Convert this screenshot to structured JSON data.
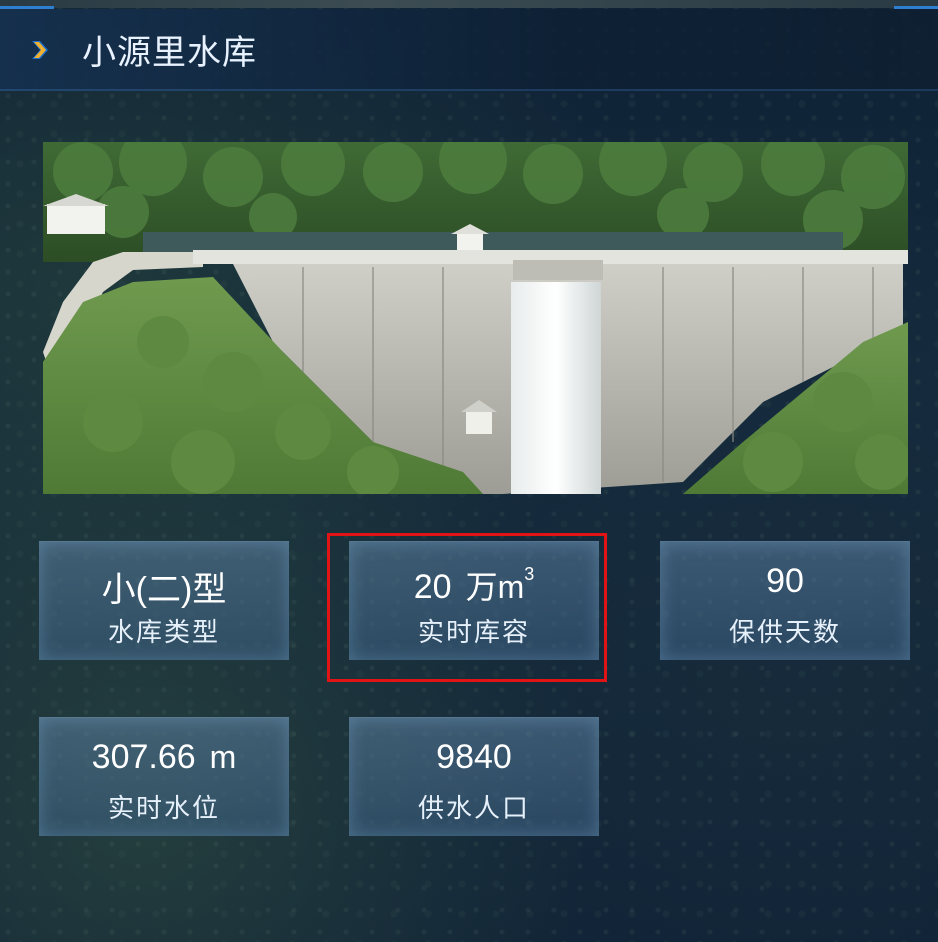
{
  "header": {
    "title": "小源里水库",
    "icon": "chevron-right-icon"
  },
  "photo": {
    "subject": "reservoir-dam-photo"
  },
  "stats": [
    {
      "value": "小(二)型",
      "unit": "",
      "label": "水库类型"
    },
    {
      "value": "20",
      "unit": "万m",
      "unit_sup": "3",
      "label": "实时库容"
    },
    {
      "value": "90",
      "unit": "",
      "label": "保供天数"
    },
    {
      "value": "307.66",
      "unit": "m",
      "label": "实时水位"
    },
    {
      "value": "9840",
      "unit": "",
      "label": "供水人口"
    }
  ],
  "colors": {
    "accent": "#2f7fd0",
    "chevron": "#f0b030",
    "highlight": "#e01414",
    "card_bg": "#4a7296"
  }
}
